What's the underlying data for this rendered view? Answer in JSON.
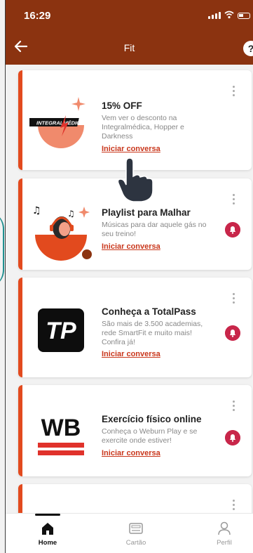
{
  "status_bar": {
    "time": "16:29"
  },
  "app_bar": {
    "title": "Fit",
    "help_label": "?"
  },
  "cards": [
    {
      "title": "15% OFF",
      "description": "Vem ver o desconto na Integralmédica, Hopper e Darkness",
      "link": "Iniciar conversa",
      "brand": "INTEGRALMÉDICA",
      "has_bell": false
    },
    {
      "title": "Playlist para Malhar",
      "description": "Músicas para dar aquele gás no seu treino!",
      "link": "Iniciar conversa",
      "has_bell": true
    },
    {
      "title": "Conheça a TotalPass",
      "description": "São mais de 3.500 academias, rede SmartFit e muito mais! Confira já!",
      "link": "Iniciar conversa",
      "brand": "TP",
      "has_bell": true
    },
    {
      "title": "Exercício físico online",
      "description": "Conheça o Weburn Play e se exercite onde estiver!",
      "link": "Iniciar conversa",
      "brand": "WB",
      "has_bell": true
    }
  ],
  "tabs": [
    {
      "label": "Home",
      "active": true,
      "icon": "home-icon"
    },
    {
      "label": "Cartão",
      "active": false,
      "icon": "card-icon"
    },
    {
      "label": "Perfil",
      "active": false,
      "icon": "person-icon"
    }
  ],
  "colors": {
    "header": "#8b3310",
    "accent_stripe": "#e24a1e",
    "link": "#c9371c",
    "bell": "#c8264a",
    "salmon": "#f08a6c"
  }
}
